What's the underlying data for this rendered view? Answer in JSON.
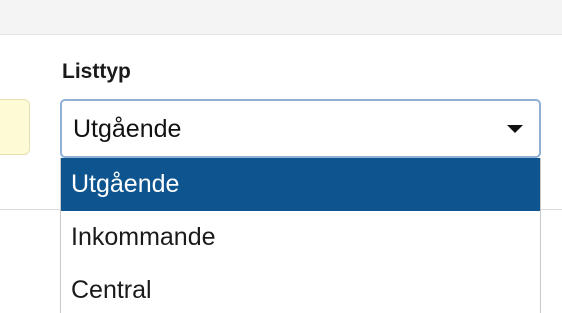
{
  "form": {
    "field_label": "Listtyp",
    "select_value": "Utgående",
    "options": [
      {
        "label": "Utgående",
        "selected": true
      },
      {
        "label": "Inkommande",
        "selected": false
      },
      {
        "label": "Central",
        "selected": false
      }
    ]
  },
  "colors": {
    "selected_option_bg": "#0e5590",
    "select_border": "#8fb1d6",
    "left_field_bg": "#fdfbd6"
  },
  "icons": {
    "caret": "chevron-down-icon"
  }
}
